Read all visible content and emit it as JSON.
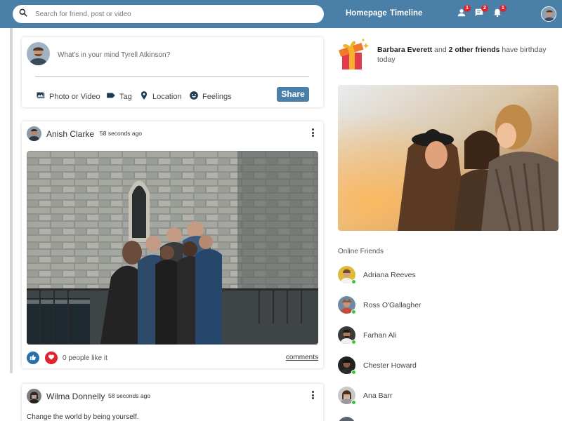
{
  "search": {
    "placeholder": "Search for friend, post or video"
  },
  "nav": {
    "homepage": "Homepage",
    "timeline": "Timeline"
  },
  "notifications": {
    "friends_count": "1",
    "messages_count": "2",
    "alerts_count": "1"
  },
  "composer": {
    "prompt": "What's in your mind Tyrell Atkinson?",
    "photo_label": "Photo or Video",
    "tag_label": "Tag",
    "location_label": "Location",
    "feelings_label": "Feelings",
    "share_label": "Share"
  },
  "posts": [
    {
      "author": "Anish Clarke",
      "time": "58 seconds ago",
      "likes_text": "0 people like it",
      "comments_label": "comments"
    },
    {
      "author": "Wilma Donnelly",
      "time": "58 seconds ago",
      "text": "Change the world by being yourself."
    }
  ],
  "birthday": {
    "name": "Barbara Everett",
    "middle": " and ",
    "others": "2 other friends",
    "suffix": " have birthday today"
  },
  "online": {
    "title": "Online Friends",
    "friends": [
      "Adriana Reeves",
      "Ross O'Gallagher",
      "Farhan Ali",
      "Chester Howard",
      "Ana Barr"
    ]
  },
  "colors": {
    "brand": "#4a7fa7",
    "badge": "#e0242e",
    "online": "#3ec43e",
    "like": "#2e6fa7",
    "heart": "#e0242e"
  },
  "icons": [
    "search-icon",
    "person-icon",
    "chat-icon",
    "bell-icon",
    "photo-icon",
    "tag-icon",
    "location-icon",
    "feelings-icon",
    "gift-icon",
    "thumb-up-icon",
    "heart-icon",
    "more-vert-icon"
  ]
}
